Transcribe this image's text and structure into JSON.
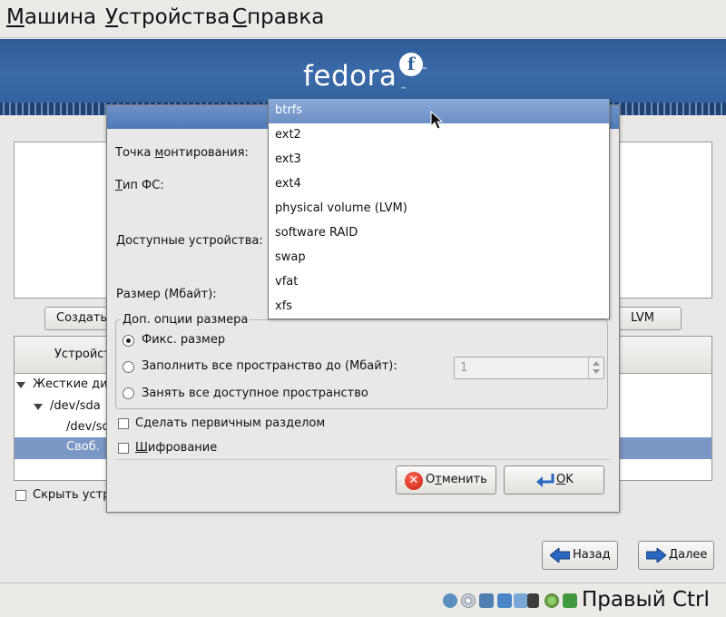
{
  "vbox_menu": {
    "items": [
      {
        "label": "Машина",
        "ul": "М",
        "rest": "ашина"
      },
      {
        "label": "Устройства",
        "ul": "У",
        "rest": "стройства"
      },
      {
        "label": "Справка",
        "ul": "С",
        "rest": "правка"
      }
    ]
  },
  "banner": {
    "logo_text": "fedora",
    "logo_mark": "f",
    "tm": "™"
  },
  "background_page": {
    "create_button": "Создать",
    "lvm_button": "LVM",
    "tree_header": "Устройст",
    "tree_items": [
      "Жесткие ди",
      "/dev/sda",
      "/dev/sd",
      "Своб."
    ],
    "hide_checkbox_label": "Скрыть устр",
    "back_button": "Назад",
    "next_button": "Далее"
  },
  "dialog": {
    "mount_label_pre": "Точка ",
    "mount_label_ul": "м",
    "mount_label_post": "онтирования:",
    "fstype_label_ul": "Т",
    "fstype_label_post": "ип ФС:",
    "devices_label": "Доступные устройства:",
    "size_label": "Размер (Мбайт):",
    "size_options_legend": "Доп. опции размера",
    "radio_fixed": "Фикс. размер",
    "radio_fill_to": "Заполнить все пространство до (Мбайт):",
    "radio_fill_all": "Занять все доступное пространство",
    "fill_to_value": "1",
    "primary_checkbox": "Сделать первичным разделом",
    "encrypt_ul": "Ш",
    "encrypt_post": "ифрование",
    "cancel_pre": "О",
    "cancel_ul": "т",
    "cancel_post": "менить",
    "ok_ul": "O",
    "ok_post": "K"
  },
  "dropdown": {
    "selected": "btrfs",
    "options": [
      "btrfs",
      "ext2",
      "ext3",
      "ext4",
      "physical volume (LVM)",
      "software RAID",
      "swap",
      "vfat",
      "xfs"
    ]
  },
  "statusbar": {
    "host_key": "Правый Ctrl"
  },
  "colors": {
    "banner": "#2f5f9c",
    "selection": "#7b97c5",
    "dialog_title": "#5a80bd"
  }
}
